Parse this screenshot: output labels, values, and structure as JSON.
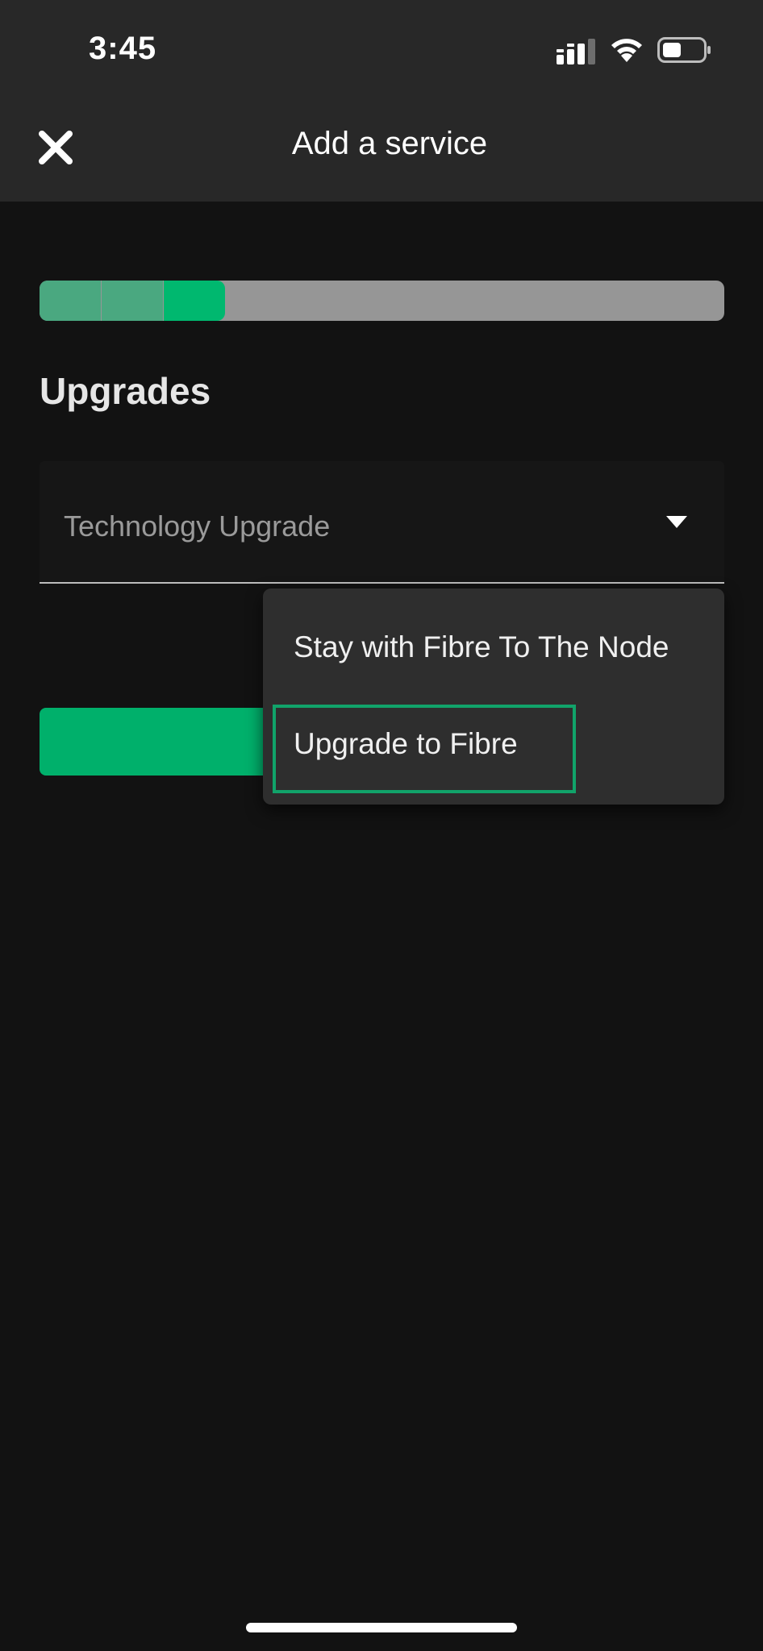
{
  "status_bar": {
    "time": "3:45",
    "icons": [
      "signal-icon",
      "wifi-icon",
      "battery-icon"
    ]
  },
  "header": {
    "title": "Add a service",
    "close_icon": "close-icon"
  },
  "progress": {
    "completed_fraction": 0.27,
    "segments": 3,
    "colors": {
      "track": "#969696",
      "done": "#4aa880",
      "current": "#00b86f"
    }
  },
  "section": {
    "title": "Upgrades"
  },
  "select": {
    "label": "Technology Upgrade",
    "icon": "chevron-down-icon"
  },
  "dropdown": {
    "options": [
      {
        "label": "Stay with Fibre To The Node"
      },
      {
        "label": "Upgrade to Fibre",
        "highlighted": true
      }
    ]
  },
  "colors": {
    "accent": "#00b06b",
    "background": "#121212",
    "header_bg": "#282828",
    "menu_bg": "#2e2e2e"
  }
}
